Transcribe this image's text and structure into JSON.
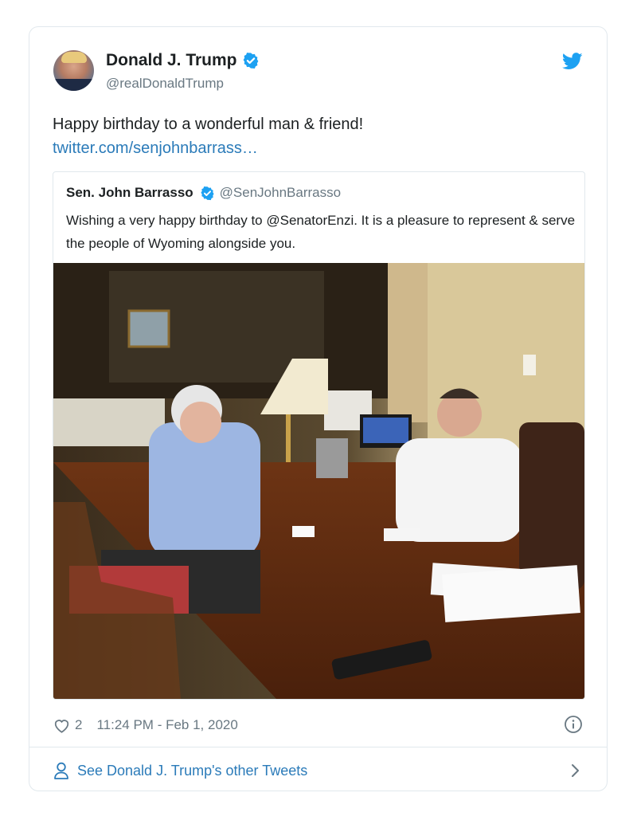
{
  "tweet": {
    "author_name": "Donald J. Trump",
    "author_handle": "@realDonaldTrump",
    "text": "Happy birthday to a wonderful man & friend!",
    "link": "twitter.com/senjohnbarrass…",
    "likes": "2",
    "timestamp": "11:24 PM - Feb 1, 2020"
  },
  "quote": {
    "author_name": "Sen. John Barrasso",
    "author_handle": "@SenJohnBarrasso",
    "text": "Wishing a very happy birthday to @SenatorEnzi. It is a pleasure to represent & serve the people of Wyoming alongside you."
  },
  "footer": {
    "more_link": "See Donald J. Trump's other Tweets"
  },
  "colors": {
    "brand_blue": "#1da1f2",
    "link_blue": "#2b7bb9",
    "muted": "#697882",
    "border": "#e1e8ed"
  },
  "icons": {
    "verified": "verified-badge-icon",
    "bird": "twitter-bird-icon",
    "heart": "heart-icon",
    "info": "info-icon",
    "person": "person-icon",
    "chevron": "chevron-right-icon"
  }
}
